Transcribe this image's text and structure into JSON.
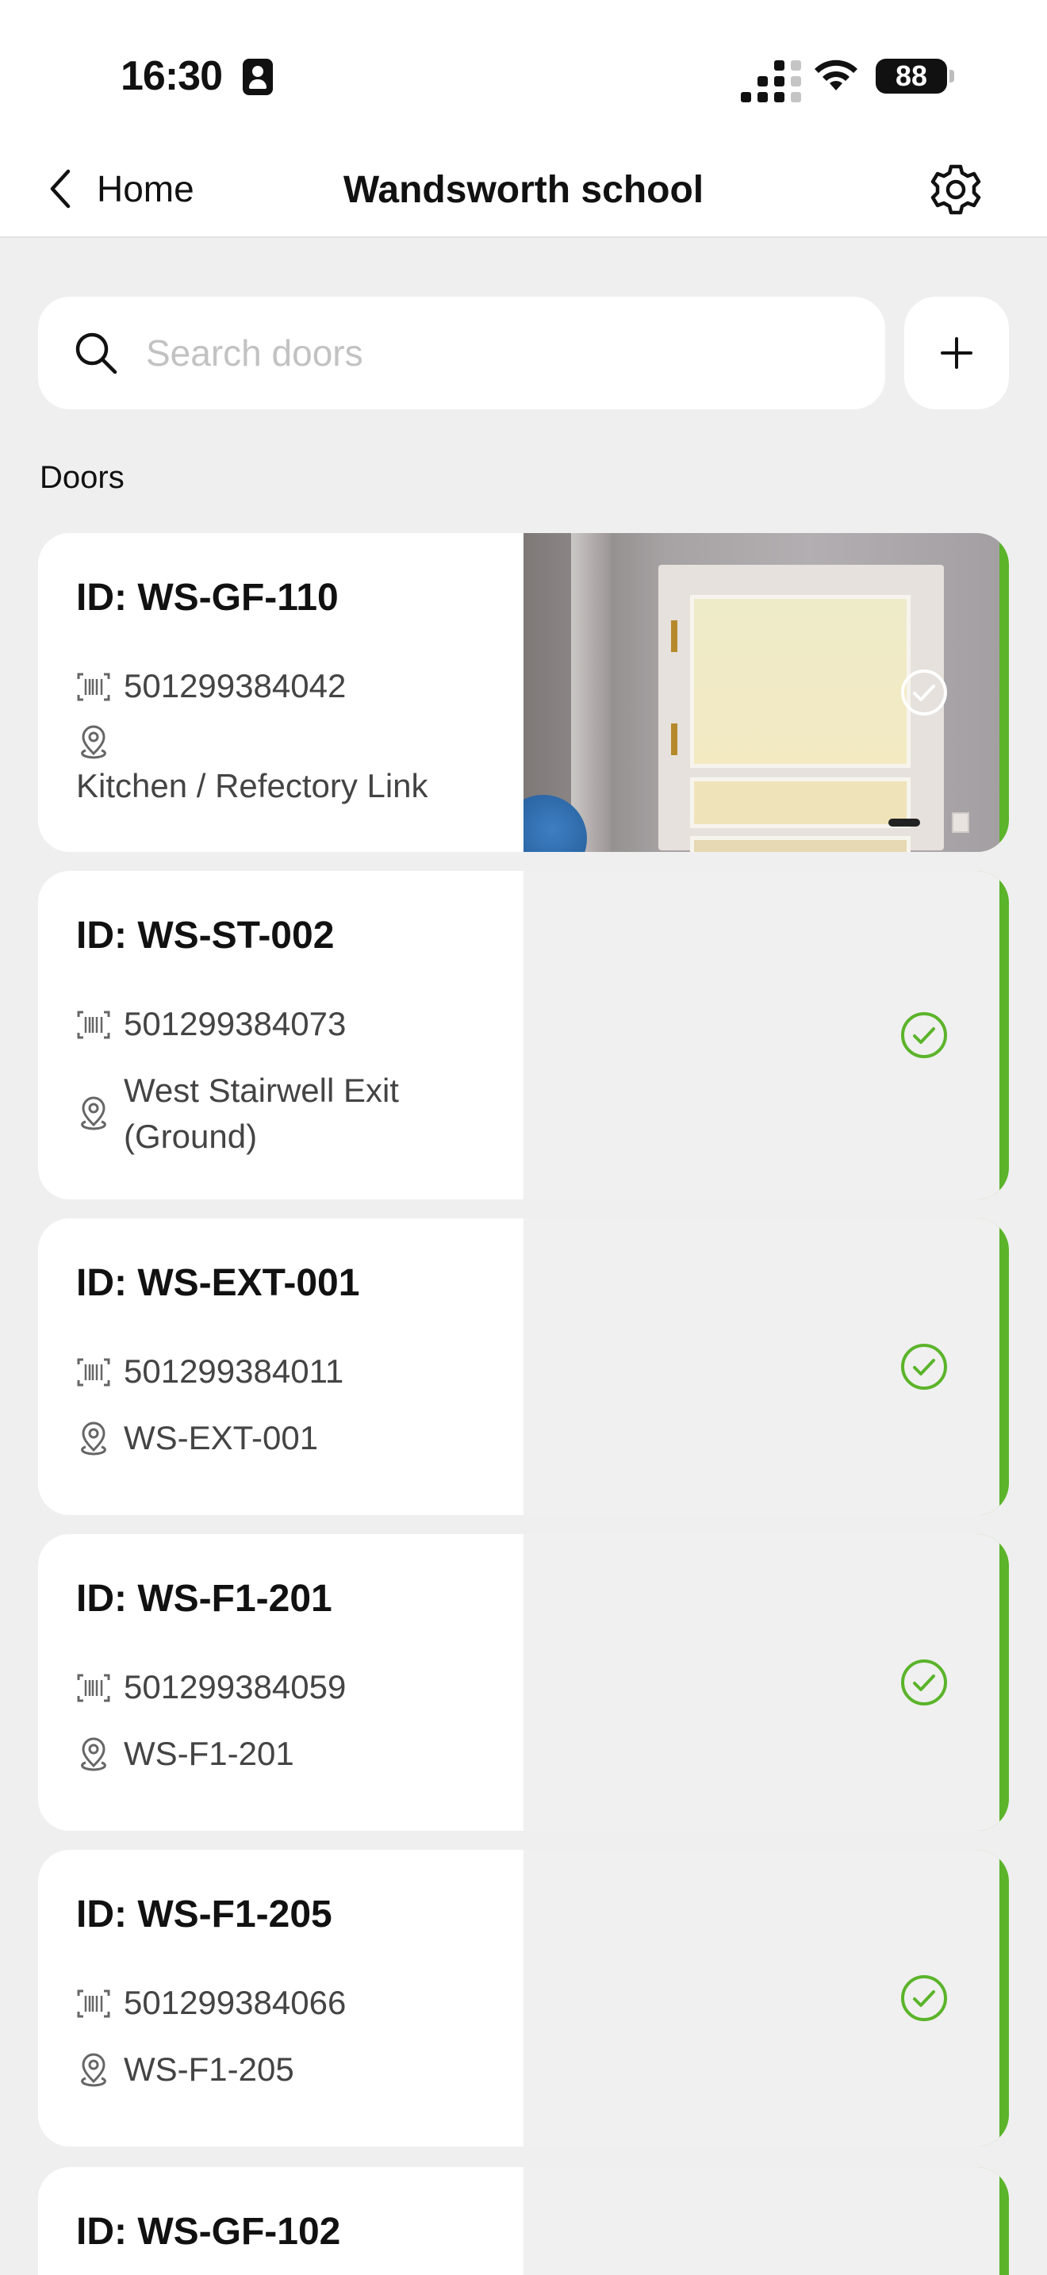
{
  "status_bar": {
    "time": "16:30",
    "battery": "88"
  },
  "nav": {
    "back_label": "Home",
    "title": "Wandsworth school"
  },
  "search": {
    "placeholder": "Search doors",
    "value": ""
  },
  "section_label": "Doors",
  "accent_color": "#5bb42a",
  "icons": {
    "barcode": "barcode-icon",
    "location": "location-pin-icon",
    "status": "check-circle-icon"
  },
  "doors": [
    {
      "id_label": "ID: WS-GF-110",
      "barcode": "501299384042",
      "location": "Kitchen / Refectory Link",
      "has_photo": true
    },
    {
      "id_label": "ID: WS-ST-002",
      "barcode": "501299384073",
      "location": "West Stairwell Exit (Ground)",
      "has_photo": false
    },
    {
      "id_label": "ID: WS-EXT-001",
      "barcode": "501299384011",
      "location": "WS-EXT-001",
      "has_photo": false
    },
    {
      "id_label": "ID: WS-F1-201",
      "barcode": "501299384059",
      "location": "WS-F1-201",
      "has_photo": false
    },
    {
      "id_label": "ID: WS-F1-205",
      "barcode": "501299384066",
      "location": "WS-F1-205",
      "has_photo": false
    },
    {
      "id_label": "ID: WS-GF-102",
      "has_photo": false
    }
  ]
}
